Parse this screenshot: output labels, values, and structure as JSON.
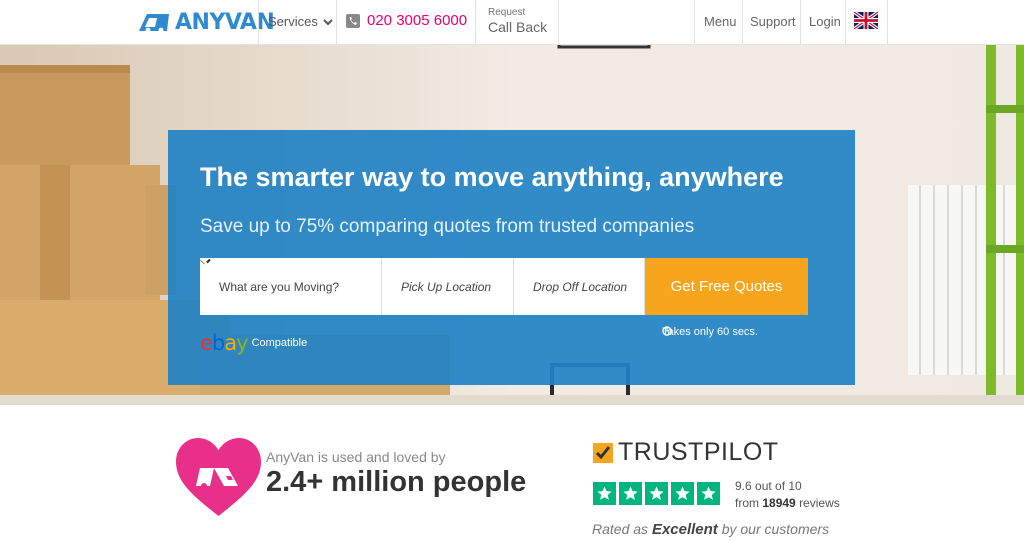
{
  "header": {
    "logo_text": "ANYVAN",
    "services_label": "Services",
    "phone": "020 3005 6000",
    "callback_small": "Request",
    "callback_big": "Call Back",
    "menu_label": "Menu",
    "support_label": "Support",
    "login_label": "Login",
    "flag_icon": "uk-flag-icon"
  },
  "hero": {
    "headline": "The smarter way to move anything, anywhere",
    "subheadline": "Save up to 75% comparing quotes from trusted companies",
    "what_placeholder": "What are you Moving?",
    "pickup_placeholder": "Pick Up Location",
    "dropoff_placeholder": "Drop Off Location",
    "cta_label": "Get Free Quotes",
    "ebay_logo": "ebay",
    "ebay_compatible": "Compatible",
    "takes_time": "Takes only 60 secs."
  },
  "social": {
    "loved_small": "AnyVan is used and loved by",
    "loved_big": "2.4+ million people"
  },
  "trustpilot": {
    "brand": "TRUSTPILOT",
    "score": "9.6 out of 10",
    "reviews_prefix": "from",
    "reviews_count": "18949",
    "reviews_suffix": "reviews",
    "rated_prefix": "Rated as",
    "rated_word": "Excellent",
    "rated_suffix": "by our customers",
    "star_count": 5
  },
  "colors": {
    "brand_blue": "#2f8ad0",
    "phone_pink": "#e6006e",
    "cta_orange": "#f7a51c",
    "trustpilot_green": "#00b67a",
    "heart_pink": "#e8308a"
  }
}
